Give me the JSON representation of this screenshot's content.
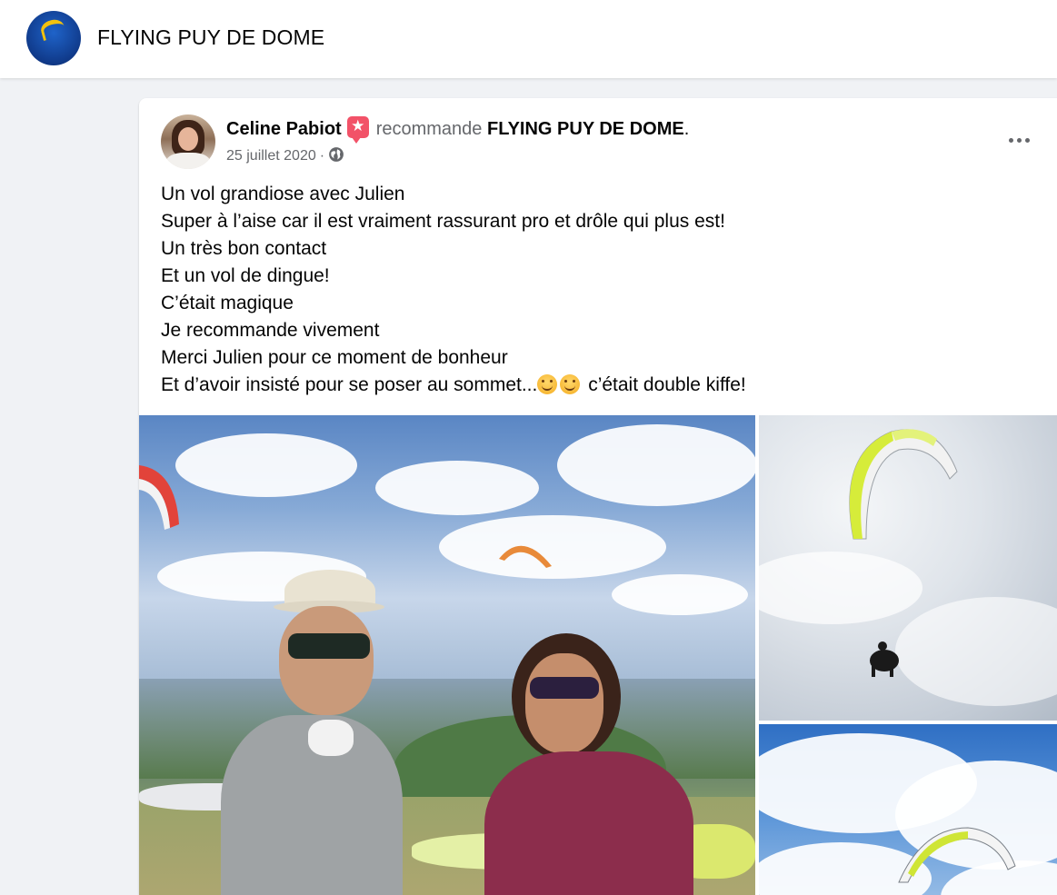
{
  "header": {
    "page_name": "FLYING PUY DE DOME",
    "logo_icon": "flying-puy-de-dome-logo"
  },
  "post": {
    "author": "Celine Pabiot",
    "badge_icon": "recommend-star-icon",
    "badge_glyph": "★",
    "recommends": "recommande",
    "recommended_page": "FLYING PUY DE DOME",
    "period": ".",
    "date": "25 juillet 2020",
    "separator": "·",
    "audience_icon": "globe-icon",
    "more_icon": "more-options-icon",
    "lines": [
      "Un vol grandiose avec Julien",
      "Super à l’aise car il est vraiment rassurant pro et drôle qui plus est!",
      "Un très bon contact",
      "Et un vol de dingue!",
      "C’était magique",
      "Je recommande vivement",
      "Merci Julien pour ce moment de bonheur"
    ],
    "last_line_start": "Et d’avoir insisté pour se poser au sommet...",
    "last_line_end": " c’était double kiffe!",
    "emoji_icon": "smiling-face-emoji"
  },
  "photos": [
    {
      "name": "two-people-on-summit-photo"
    },
    {
      "name": "paraglider-in-clouds-photo"
    },
    {
      "name": "paraglider-blue-sky-photo"
    }
  ],
  "colors": {
    "background": "#f0f2f5",
    "card": "#ffffff",
    "secondary_text": "#65676b",
    "badge": "#f25268"
  }
}
